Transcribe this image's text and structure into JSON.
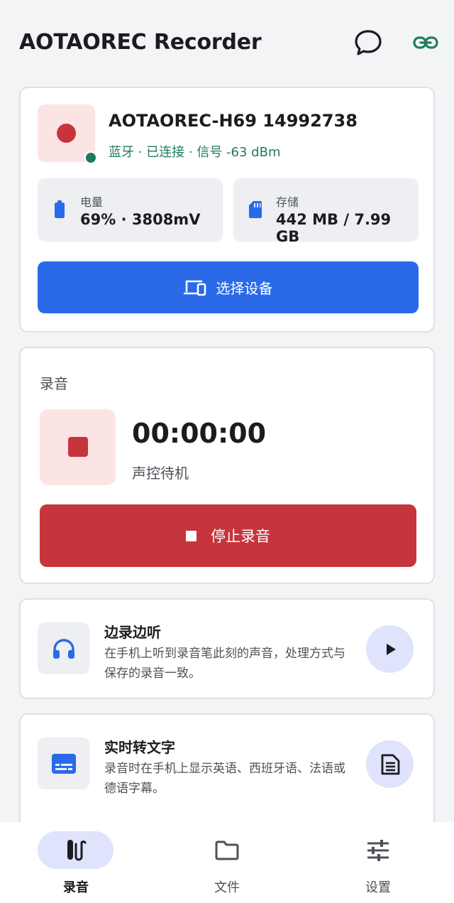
{
  "app": {
    "title": "AOTAOREC Recorder"
  },
  "colors": {
    "accent_blue": "#2a6ae8",
    "record_red": "#c6343c",
    "connected_green": "#1f7d5b",
    "background": "#f3f4f6"
  },
  "topbar": {
    "icons": [
      "chat-bubble-icon",
      "link-icon"
    ]
  },
  "device": {
    "name": "AOTAOREC-H69 14992738",
    "status": "蓝牙 · 已连接 · 信号 -63 dBm",
    "battery": {
      "label": "电量",
      "value": "69% · 3808mV",
      "level": 0.69
    },
    "storage": {
      "label": "存储",
      "value": "442 MB / 7.99 GB"
    },
    "select_button": "选择设备"
  },
  "recording": {
    "section_title": "录音",
    "timer": "00:00:00",
    "status": "声控待机",
    "stop_button": "停止录音"
  },
  "features": [
    {
      "title": "边录边听",
      "description": "在手机上听到录音笔此刻的声音，处理方式与保存的录音一致。",
      "icon": "headphones-icon",
      "action_icon": "play-icon"
    },
    {
      "title": "实时转文字",
      "description": "录音时在手机上显示英语、西班牙语、法语或德语字幕。",
      "icon": "subtitles-icon",
      "action_icon": "document-icon"
    }
  ],
  "bottom_nav": [
    {
      "label": "录音",
      "icon": "pen-recorder-icon",
      "active": true
    },
    {
      "label": "文件",
      "icon": "folder-icon",
      "active": false
    },
    {
      "label": "设置",
      "icon": "sliders-icon",
      "active": false
    }
  ]
}
